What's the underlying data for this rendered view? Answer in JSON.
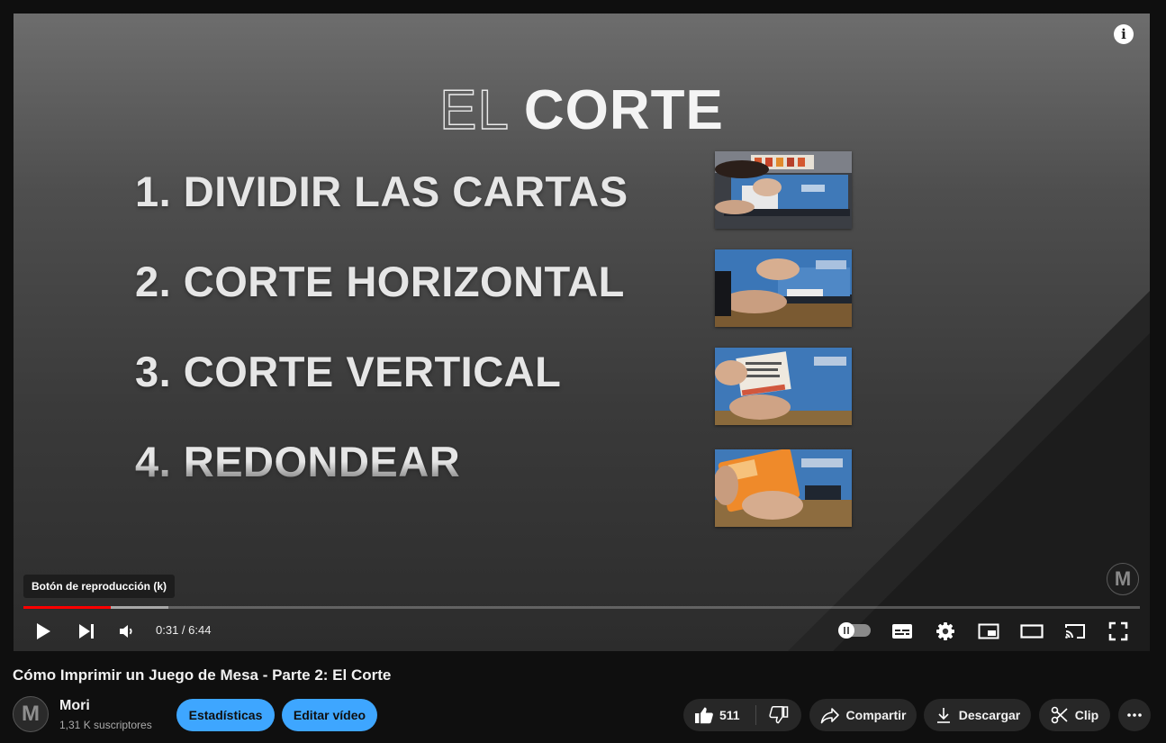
{
  "player": {
    "slide_title_light": "EL",
    "slide_title_bold": "CORTE",
    "steps": [
      "1. DIVIDIR LAS CARTAS",
      "2. CORTE HORIZONTAL",
      "3. CORTE VERTICAL",
      "4. REDONDEAR"
    ],
    "watermark_letter": "M",
    "tooltip": "Botón de reproducción (k)",
    "time": "0:31 / 6:44",
    "progress": {
      "played_fraction": 0.078,
      "buffered_fraction": 0.13
    },
    "info_icon_label": "i"
  },
  "video": {
    "title": "Cómo Imprimir un Juego de Mesa - Parte 2: El Corte"
  },
  "channel": {
    "avatar_letter": "M",
    "name": "Mori",
    "subscribers": "1,31 K suscriptores"
  },
  "actions": {
    "stats_label": "Estadísticas",
    "edit_label": "Editar vídeo",
    "like_count": "511",
    "share_label": "Compartir",
    "download_label": "Descargar",
    "clip_label": "Clip"
  },
  "colors": {
    "progress_played": "#ff0000",
    "primary_button": "#3ea6ff",
    "secondary_button": "#272727",
    "page_background": "#0f0f0f"
  },
  "icons": [
    "info-icon",
    "play-icon",
    "next-icon",
    "volume-icon",
    "autoplay-toggle-icon",
    "subtitles-icon",
    "settings-icon",
    "miniplayer-icon",
    "theater-mode-icon",
    "cast-icon",
    "fullscreen-icon",
    "like-icon",
    "dislike-icon",
    "share-icon",
    "download-icon",
    "clip-icon",
    "more-icon"
  ]
}
